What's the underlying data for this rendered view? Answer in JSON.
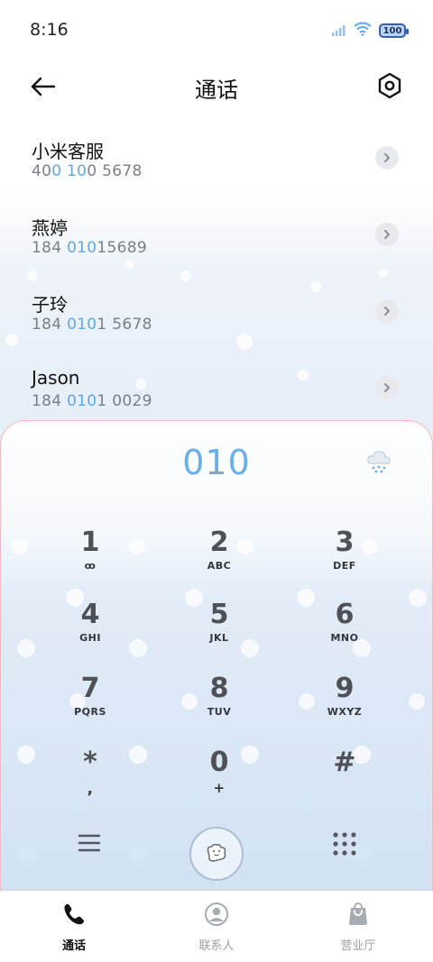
{
  "status_bar": {
    "time": "8:16",
    "battery": "100"
  },
  "header": {
    "title": "通话"
  },
  "contacts": [
    {
      "name": "小米客服",
      "number_parts": [
        "40",
        "0 10",
        "0 5678"
      ]
    },
    {
      "name": "燕婷",
      "number_parts": [
        "184 ",
        "010",
        "15689"
      ]
    },
    {
      "name": "子玲",
      "number_parts": [
        "184 ",
        "010",
        "1 5678"
      ]
    },
    {
      "name": "Jason",
      "number_parts": [
        "184 ",
        "010",
        "1 0029"
      ]
    }
  ],
  "dialpad": {
    "dialed_number": "010",
    "keys": [
      {
        "digit": "1",
        "letters": "ꝏ"
      },
      {
        "digit": "2",
        "letters": "ABC"
      },
      {
        "digit": "3",
        "letters": "DEF"
      },
      {
        "digit": "4",
        "letters": "GHI"
      },
      {
        "digit": "5",
        "letters": "JKL"
      },
      {
        "digit": "6",
        "letters": "MNO"
      },
      {
        "digit": "7",
        "letters": "PQRS"
      },
      {
        "digit": "8",
        "letters": "TUV"
      },
      {
        "digit": "9",
        "letters": "WXYZ"
      },
      {
        "digit": "*",
        "letters": ","
      },
      {
        "digit": "0",
        "letters": "+"
      },
      {
        "digit": "#",
        "letters": ""
      }
    ]
  },
  "bottom_nav": {
    "items": [
      {
        "label": "通话",
        "icon": "phone-icon",
        "active": true
      },
      {
        "label": "联系人",
        "icon": "person-icon",
        "active": false
      },
      {
        "label": "营业厅",
        "icon": "bag-icon",
        "active": false
      }
    ]
  },
  "colors": {
    "accent": "#6aaee8",
    "highlight_digits": "#5ea7e4",
    "dialpad_border": "#f2b9be"
  }
}
